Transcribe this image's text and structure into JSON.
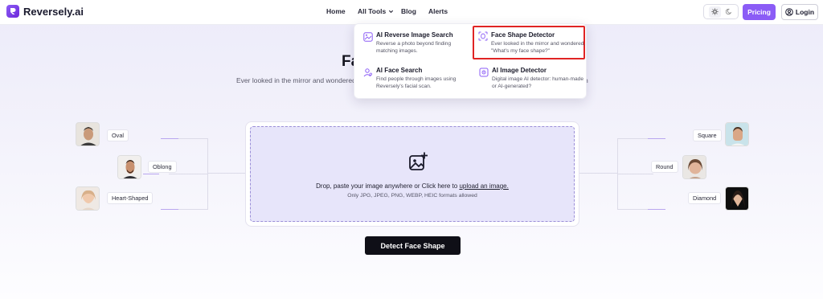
{
  "header": {
    "logo_text": "Reversely.ai",
    "nav": {
      "home": "Home",
      "all_tools": "All Tools",
      "blog": "Blog",
      "alerts": "Alerts"
    },
    "pricing_label": "Pricing",
    "login_label": "Login"
  },
  "hero": {
    "title_visible": "Fa",
    "subtitle_visible": "Ever looked in the mirror and wondered",
    "subtitle_tail_visible": "n"
  },
  "dropdown": {
    "items": [
      {
        "title": "AI Reverse Image Search",
        "desc": "Reverse a photo beyond finding matching images.",
        "icon": "image-search-icon"
      },
      {
        "title": "Face Shape Detector",
        "desc": "Ever looked in the mirror and wondered, \"What's my face shape?\"",
        "icon": "face-scan-icon"
      },
      {
        "title": "AI Face Search",
        "desc": "Find people through images using Reversely's facial scan.",
        "icon": "face-search-icon"
      },
      {
        "title": "AI Image Detector",
        "desc": "Digital image AI detector: human-made or AI-generated?",
        "icon": "image-detect-icon"
      }
    ]
  },
  "upload": {
    "prompt": "Drop, paste your image anywhere or Click here to ",
    "link": "upload an image.",
    "formats": "Only JPG, JPEG, PNG, WEBP, HEIC formats allowed"
  },
  "detect_button": "Detect Face Shape",
  "face_shapes": {
    "left": [
      "Oval",
      "Oblong",
      "Heart-Shaped"
    ],
    "right": [
      "Square",
      "Round",
      "Diamond"
    ]
  },
  "colors": {
    "accent": "#8b5cf6",
    "highlight": "#e02424",
    "dark_button": "#0f0f17"
  }
}
